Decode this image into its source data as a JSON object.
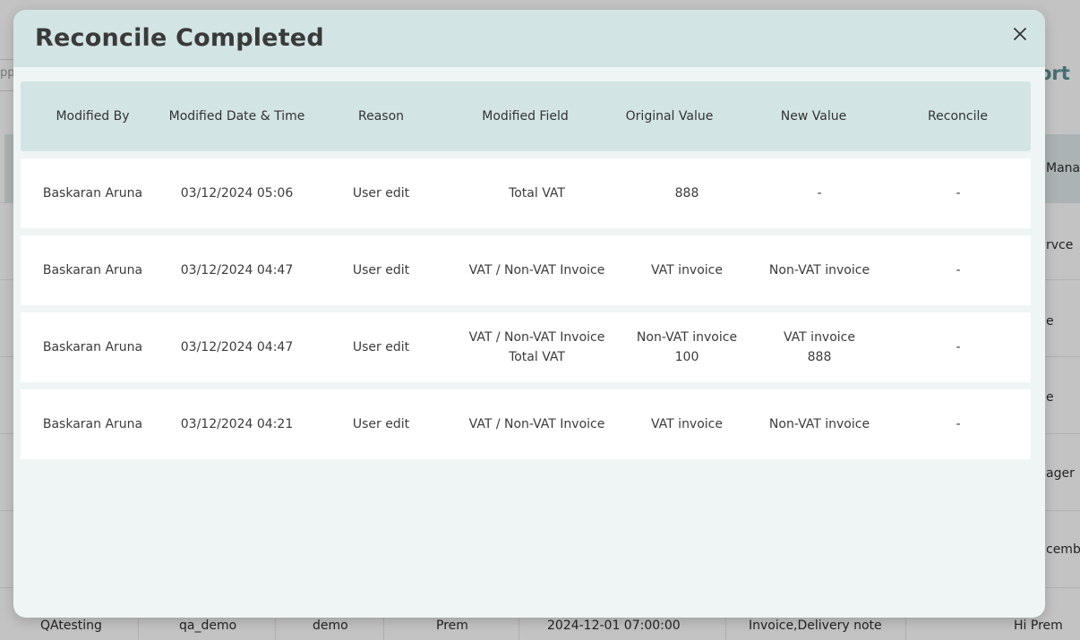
{
  "background": {
    "search_fragment": "pp",
    "report_fragment": "ort",
    "header_fragment": "Mana",
    "row_fragments": [
      "rvce",
      "e",
      "e",
      "ager",
      "cembe"
    ],
    "last_row": [
      "QAtesting",
      "qa_demo",
      "demo",
      "Prem",
      "2024-12-01 07:00:00",
      "Invoice,Delivery note",
      "Hi Prem"
    ]
  },
  "modal": {
    "title": "Reconcile Completed",
    "close_icon": "close-icon"
  },
  "table": {
    "headers": [
      "Modified By",
      "Modified Date & Time",
      "Reason",
      "Modified Field",
      "Original Value",
      "New Value",
      "Reconcile"
    ],
    "rows": [
      {
        "modified_by": "Baskaran Aruna",
        "datetime": "03/12/2024 05:06",
        "reason": "User edit",
        "field": [
          "Total VAT"
        ],
        "original": [
          "888"
        ],
        "new": [
          "-"
        ],
        "reconcile": "-"
      },
      {
        "modified_by": "Baskaran Aruna",
        "datetime": "03/12/2024 04:47",
        "reason": "User edit",
        "field": [
          "VAT / Non-VAT Invoice"
        ],
        "original": [
          "VAT invoice"
        ],
        "new": [
          "Non-VAT invoice"
        ],
        "reconcile": "-"
      },
      {
        "modified_by": "Baskaran Aruna",
        "datetime": "03/12/2024 04:47",
        "reason": "User edit",
        "field": [
          "VAT / Non-VAT Invoice",
          "Total VAT"
        ],
        "original": [
          "Non-VAT invoice",
          "100"
        ],
        "new": [
          "VAT invoice",
          "888"
        ],
        "reconcile": "-"
      },
      {
        "modified_by": "Baskaran Aruna",
        "datetime": "03/12/2024 04:21",
        "reason": "User edit",
        "field": [
          "VAT / Non-VAT Invoice"
        ],
        "original": [
          "VAT invoice"
        ],
        "new": [
          "Non-VAT invoice"
        ],
        "reconcile": "-"
      }
    ]
  }
}
